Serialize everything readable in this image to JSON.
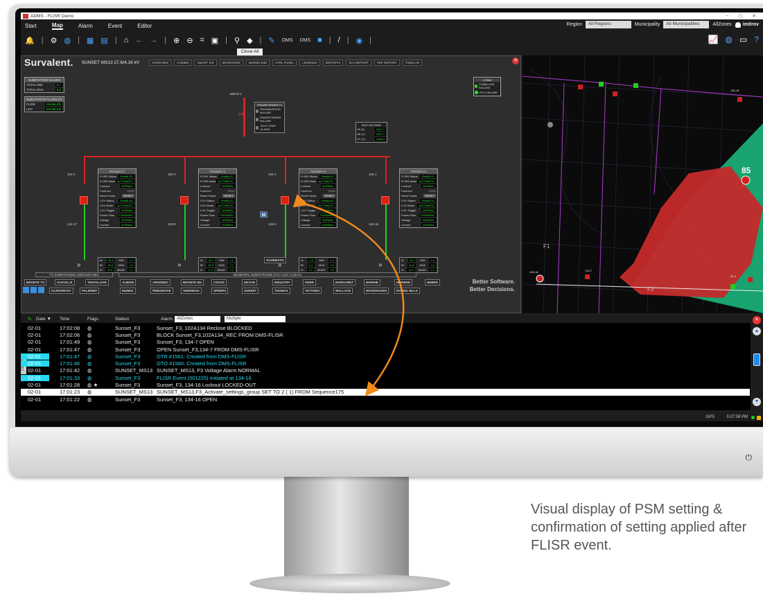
{
  "window": {
    "title": "ADMS - FLISR Demo",
    "controls": [
      "–",
      "▢",
      "✕"
    ]
  },
  "menu": {
    "items": [
      "Start",
      "Map",
      "Alarm",
      "Event",
      "Editor"
    ],
    "active": "Map",
    "region_label": "Region",
    "region_value": "All Regions",
    "municipality_label": "Municipality",
    "municipality_value": "All Municipalities",
    "allzones": "AllZones",
    "user": "imitrov"
  },
  "toolbar": {
    "oms": "OMS",
    "dms": "DMS"
  },
  "close_all": "Close All",
  "diagram": {
    "brand": "Survalent.",
    "subtitle": "SUNSET MS13  27.6/4.16 kV",
    "tabs": [
      "OVERVIEW",
      "COMMS",
      "SMART S/S",
      "MICROGRID",
      "DERMS-D30",
      "CTRL PANEL",
      "LEGENDS",
      "REPORTS",
      "XLS REPORT",
      "PDF REPORT",
      "TABULAR"
    ],
    "substation_values": {
      "header": "SUBSTATION VALUES",
      "rows": [
        {
          "label": "TOTAL MW",
          "value": "8.7"
        },
        {
          "label": "TOTAL MVA",
          "value": "8.8"
        }
      ]
    },
    "substation_flisr": {
      "header": "SUBSTATION FLISR/LOV",
      "rows": [
        {
          "label": "FLISR",
          "value": "ENABLED"
        },
        {
          "label": "LOV",
          "value": "ENABLED"
        }
      ]
    },
    "comm": {
      "header": "COMM",
      "rows": [
        "COMM LINE FAILURE",
        "RTU FAILURE"
      ]
    },
    "transformer": {
      "header": "TRANSFORMER T1",
      "rows": [
        "TRANSMISSION FAILURE",
        "TRANSFORMER FAILURE",
        "HIGH TEMP. ALARM"
      ]
    },
    "bus_voltage": {
      "header": "BUS VOLTAGE",
      "rows": [
        {
          "label": "VA (V)",
          "value": "2497.7"
        },
        {
          "label": "VB (V)",
          "value": "2497.4"
        },
        {
          "label": "VC (V)",
          "value": "2486.5"
        }
      ]
    },
    "ab_label": "AB073-1",
    "feeders": [
      {
        "name": "FEEDER F1",
        "tag_top": "131-1",
        "tag_bot": "131-17",
        "flisr_status": "ENABLED",
        "flisr_mode": "AUTOMATIC",
        "lockout": "NORMAL",
        "lov_status": "ENABLED",
        "lov_mode": "AUTOMATIC",
        "lov_trigger": "NORMAL",
        "power_flow": "FORWARD",
        "voltage": "NORMAL",
        "current": "NORMAL",
        "ia": "40.6",
        "ib": "35.8",
        "ic": "29.9",
        "mw": "0.2",
        "mva": "0.2",
        "mvar": "0.1"
      },
      {
        "name": "FEEDER F2",
        "tag_top": "132-1",
        "tag_bot": "132-8",
        "flisr_status": "ENABLED",
        "flisr_mode": "AUTOMATIC",
        "lockout": "NORMAL",
        "lov_status": "ENABLED",
        "lov_mode": "AUTOMATIC",
        "lov_trigger": "NORMAL",
        "power_flow": "FORWARD",
        "voltage": "NORMAL",
        "current": "NORMAL",
        "ia": "23.1",
        "ib": "18.5",
        "ic": "17.9",
        "mw": "0.1",
        "mva": "0.1",
        "mvar": "0.1"
      },
      {
        "name": "FEEDER F3",
        "tag_top": "133-1",
        "tag_bot": "133-5",
        "flisr_status": "ENABLED",
        "flisr_mode": "AUTOMATIC",
        "lockout": "NORMAL",
        "lov_status": "ENABLED",
        "lov_mode": "AUTOMATIC",
        "lov_trigger": "NORMAL",
        "power_flow": "FORWARD",
        "voltage": "NORMAL",
        "current": "NORMAL",
        "ia": "0.0",
        "ib": "0.0",
        "ic": "0.0",
        "mw": "0.0",
        "mva": "0.0",
        "mvar": "0.0"
      },
      {
        "name": "FEEDER F4",
        "tag_top": "134-1",
        "tag_bot": "134-16",
        "flisr_status": "ENABLED",
        "flisr_mode": "AUTOMATIC",
        "lockout": "NORMAL",
        "lov_status": "ENABLED",
        "lov_mode": "AUTOMATIC",
        "lov_trigger": "NORMAL",
        "power_flow": "FORWARD",
        "voltage": "NORMAL",
        "current": "NORMAL",
        "ia": "41.1",
        "ib": "40.6",
        "ic": "42.2",
        "mw": "0.4",
        "mva": "0.4",
        "mvar": "0.1"
      }
    ],
    "feeder_labels": {
      "flisr_status": "FLISR Status",
      "flisr_mode": "FLISR Mode",
      "lockout": "Lockout",
      "fault_ind": "Fault Ind",
      "reset_faults": "Reset Faults",
      "reset_btn": "RESET",
      "lov_status": "LOV Status",
      "lov_mode": "LOV Mode",
      "lov_trigger": "LOV Trigger",
      "power_flow": "Power Flow",
      "voltage": "Voltage",
      "current": "Current"
    },
    "schematic_btn": "SCHEMATIC",
    "tx_header": "TX SUBSTATIONS 230/115/27.6KV",
    "ms_header": "MUNICIPAL SUBSTATIONS 27.6 / 13.8 / 4.16 KV",
    "tx_stations": [
      "BRONTE TS",
      "OAKVILLE",
      "TRAFALGAR",
      "GLENORCHY",
      "PALERMO"
    ],
    "ms_row1": [
      "ALBION",
      "ARKENDO",
      "BRONTE MS",
      "CROSS",
      "DEVON",
      "INDUSTRY",
      "KERR",
      "MARGARET",
      "MARINE",
      "MODERN",
      "NEBER"
    ],
    "ms_row2": [
      "MUNNS",
      "PINEGROVE",
      "SHERIDAN",
      "SPEERS",
      "SUNSET",
      "THOMAS",
      "VICTORIA",
      "WALLACE",
      "WOODHAVEN",
      "ROUND HILLS"
    ],
    "tagline_1": "Better Software.",
    "tagline_2": "Better Decisions."
  },
  "map": {
    "feeder_label_f1": "F1",
    "feeder_label_f3": "F3",
    "count": "85",
    "labels": [
      "S1-1",
      "134-16",
      "134-7",
      "135-16"
    ]
  },
  "alarm_panel": {
    "columns": {
      "date": "Date ▼",
      "time": "Time",
      "flags": "Flags",
      "station": "Station",
      "alarm": "Alarm"
    },
    "zone_filter": "AllZones",
    "type_filter": "Multiple",
    "close_all_vertical": "Close All",
    "rows": [
      {
        "date": "02-01",
        "time": "17:02:08",
        "flag": "◍",
        "station": "Sunset_F3",
        "text": "Sunset_F3, 102A134 Reclose BLOCKED",
        "style": ""
      },
      {
        "date": "02-01",
        "time": "17:02:06",
        "flag": "◍",
        "station": "Sunset_F3",
        "text": "BLOCK  Sunset_F3,102A134_REC FROM DMS-FLISR",
        "style": ""
      },
      {
        "date": "02-01",
        "time": "17:01:49",
        "flag": "◍",
        "station": "Sunset_F3",
        "text": "Sunset_F3, 134-7 OPEN",
        "style": ""
      },
      {
        "date": "02-01",
        "time": "17:01:47",
        "flag": "◍",
        "station": "Sunset_F3",
        "text": "OPEN  Sunset_F3,134-7 FROM DMS-FLISR",
        "style": ""
      },
      {
        "date": "02-01",
        "time": "17:01:47",
        "flag": "◍",
        "station": "Sunset_F3",
        "text": "OTR #1561: Created from DMS-FLISR",
        "style": "cyan"
      },
      {
        "date": "02-01",
        "time": "17:01:46",
        "flag": "◍",
        "station": "Sunset_F3",
        "text": "OTO #1560: Created from DMS-FLISR",
        "style": "cyan"
      },
      {
        "date": "02-01",
        "time": "17:01:42",
        "flag": "◍",
        "station": "SUNSET_MS13",
        "text": "SUNSET_MS13, F3 Voltage Alarm NORMAL",
        "style": ""
      },
      {
        "date": "02-01",
        "time": "17:01:33",
        "flag": "◍",
        "station": "Sunset_F3",
        "text": "FLISR Event (001225) Initiated at 134-16",
        "style": "cyan"
      },
      {
        "date": "02-01",
        "time": "17:01:28",
        "flag": "◍ ★",
        "station": "Sunset_F3",
        "text": "Sunset_F3, 134-16 Lockout LOCKED-OUT",
        "style": ""
      },
      {
        "date": "02-01",
        "time": "17:01:23",
        "flag": "◍",
        "station": "SUNSET_MS13",
        "text": "SUNSET_MS13,F3_Activate_settings_group SET TO      2 (      1) FROM Sequence175",
        "style": "sel"
      },
      {
        "date": "02-01",
        "time": "17:01:22",
        "flag": "◍",
        "station": "Sunset_F3",
        "text": "Sunset_F3, 134-16 OPEN",
        "style": ""
      }
    ]
  },
  "status_bar": {
    "gps": "GPS",
    "time": "5:07:58 PM"
  },
  "power_icon": "⏻",
  "caption": "Visual display of PSM setting & confirmation of setting applied after FLISR event.",
  "colors": {
    "accent_orange": "#f08a1c",
    "alarm_cyan": "#27d9f0",
    "fault_red": "#d22",
    "ok_green": "#3cf03c"
  }
}
